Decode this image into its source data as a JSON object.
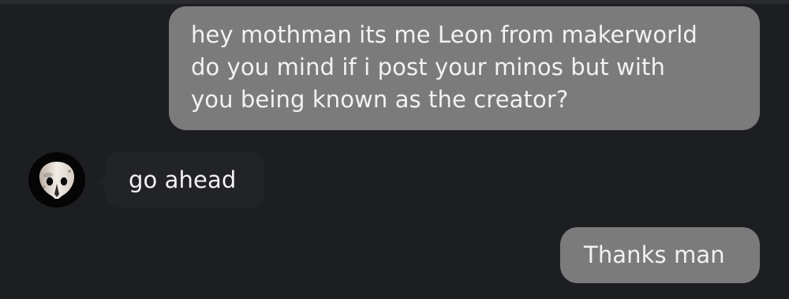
{
  "conversation": {
    "messages": [
      {
        "sender": "me",
        "lines": [
          "hey mothman its me Leon from makerworld",
          "do you mind if i post your minos but with",
          "you being known as the creator?"
        ]
      },
      {
        "sender": "other",
        "text": "go ahead",
        "avatar_icon": "mask-avatar-icon"
      },
      {
        "sender": "me",
        "text": "Thanks man"
      }
    ]
  },
  "colors": {
    "background": "#1d1e22",
    "outgoing_bubble": "#7b7b7b",
    "incoming_bubble": "#222327",
    "text": "#f2f2f2",
    "avatar_background": "#050505"
  }
}
